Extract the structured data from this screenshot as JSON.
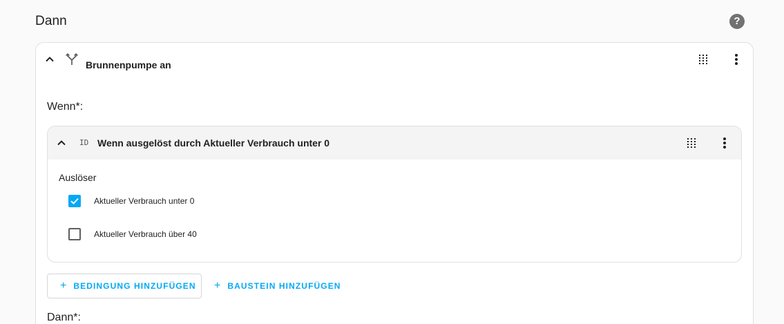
{
  "section": {
    "title": "Dann"
  },
  "help": {
    "glyph": "?"
  },
  "outer_card": {
    "title": "Brunnenpumpe an",
    "wenn_label": "Wenn*:",
    "dann_label": "Dann*:"
  },
  "inner_card": {
    "icon_text": "ID",
    "title": "Wenn ausgelöst durch Aktueller Verbrauch unter 0",
    "trigger_label": "Auslöser",
    "options": [
      {
        "label": "Aktueller Verbrauch unter 0",
        "checked": true
      },
      {
        "label": "Aktueller Verbrauch über 40",
        "checked": false
      }
    ]
  },
  "buttons": {
    "add_condition": "BEDINGUNG HINZUFÜGEN",
    "add_block": "BAUSTEIN HINZUFÜGEN",
    "plus": "+"
  },
  "colors": {
    "accent": "#03a9f4",
    "background": "#fafafa",
    "header_gray": "#f4f4f4"
  }
}
